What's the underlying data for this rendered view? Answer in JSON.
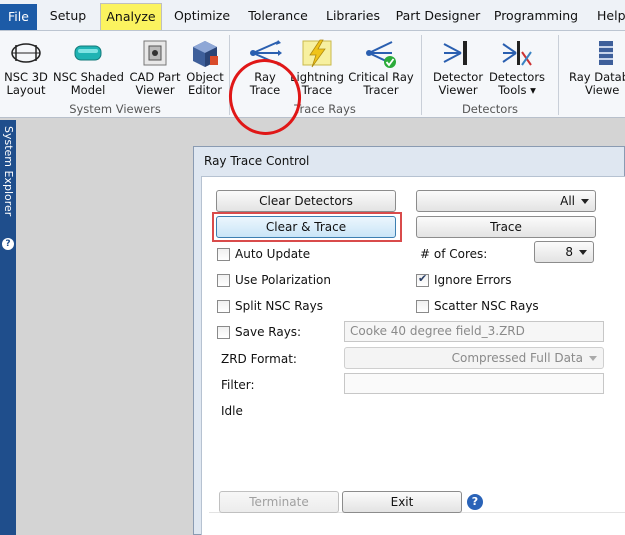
{
  "menu": {
    "tabs": [
      "File",
      "Setup",
      "Analyze",
      "Optimize",
      "Tolerance",
      "Libraries",
      "Part Designer",
      "Programming",
      "Help"
    ],
    "active": "Analyze"
  },
  "ribbon": {
    "system_viewers": {
      "label": "System Viewers",
      "buttons": [
        {
          "line1": "NSC 3D",
          "line2": "Layout"
        },
        {
          "line1": "NSC Shaded",
          "line2": "Model"
        },
        {
          "line1": "CAD Part",
          "line2": "Viewer"
        },
        {
          "line1": "Object",
          "line2": "Editor"
        }
      ]
    },
    "trace_rays": {
      "label": "Trace Rays",
      "buttons": [
        {
          "line1": "Ray",
          "line2": "Trace"
        },
        {
          "line1": "Lightning",
          "line2": "Trace"
        },
        {
          "line1": "Critical Ray",
          "line2": "Tracer"
        }
      ]
    },
    "detectors": {
      "label": "Detectors",
      "buttons": [
        {
          "line1": "Detector",
          "line2": "Viewer"
        },
        {
          "line1": "Detectors",
          "line2": "Tools ▾"
        }
      ]
    },
    "extra": {
      "line1": "Ray Databa",
      "line2": "Viewe"
    }
  },
  "sidebar": {
    "label": "System Explorer",
    "help": "?"
  },
  "dialog": {
    "title": "Ray Trace Control",
    "clear_detectors": "Clear Detectors",
    "detector_select": "All",
    "clear_trace": "Clear & Trace",
    "trace": "Trace",
    "auto_update": "Auto Update",
    "cores_label": "# of Cores:",
    "cores_value": "8",
    "use_polarization": "Use Polarization",
    "ignore_errors": "Ignore Errors",
    "split_nsc": "Split NSC Rays",
    "scatter_nsc": "Scatter NSC Rays",
    "save_rays": "Save Rays:",
    "save_rays_file": "Cooke 40 degree field_3.ZRD",
    "zrd_format_label": "ZRD Format:",
    "zrd_format_value": "Compressed Full Data",
    "filter_label": "Filter:",
    "filter_value": "",
    "status": "Idle",
    "terminate": "Terminate",
    "exit": "Exit",
    "help": "?"
  },
  "colors": {
    "file_tab": "#1c5ba7",
    "active_tab": "#fbf35f",
    "annotation_red": "#e01717",
    "sidebar": "#1f4e8c"
  }
}
